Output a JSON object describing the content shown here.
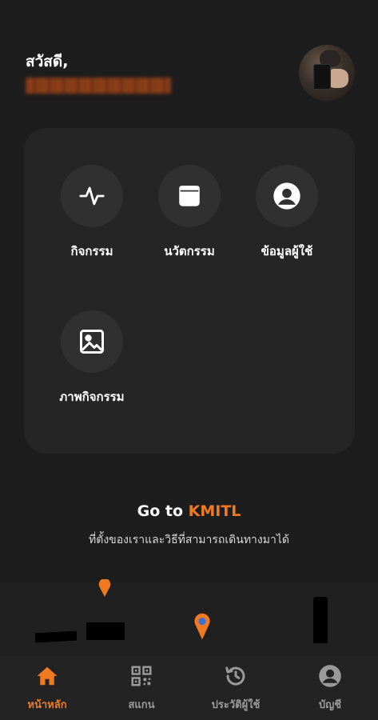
{
  "header": {
    "greeting": "สวัสดี,"
  },
  "menu": {
    "items": [
      {
        "label": "กิจกรรม",
        "icon": "activity-pulse-icon"
      },
      {
        "label": "นวัตกรรม",
        "icon": "window-icon"
      },
      {
        "label": "ข้อมูลผู้ใช้",
        "icon": "user-circle-icon"
      },
      {
        "label": "ภาพกิจกรรม",
        "icon": "image-icon"
      }
    ]
  },
  "goto": {
    "prefix": "Go to",
    "highlight": "KMITL",
    "subtitle": "ที่ตั้งของเราและวิธีที่สามารถเดินทางมาได้"
  },
  "bottom_nav": {
    "items": [
      {
        "label": "หน้าหลัก",
        "icon": "home-icon",
        "active": true
      },
      {
        "label": "สแกน",
        "icon": "qr-code-icon",
        "active": false
      },
      {
        "label": "ประวัติผู้ใช้",
        "icon": "history-icon",
        "active": false
      },
      {
        "label": "บัญชี",
        "icon": "account-icon",
        "active": false
      }
    ]
  },
  "colors": {
    "accent": "#f07a20",
    "background": "#1d1d1d",
    "card": "#252525"
  }
}
